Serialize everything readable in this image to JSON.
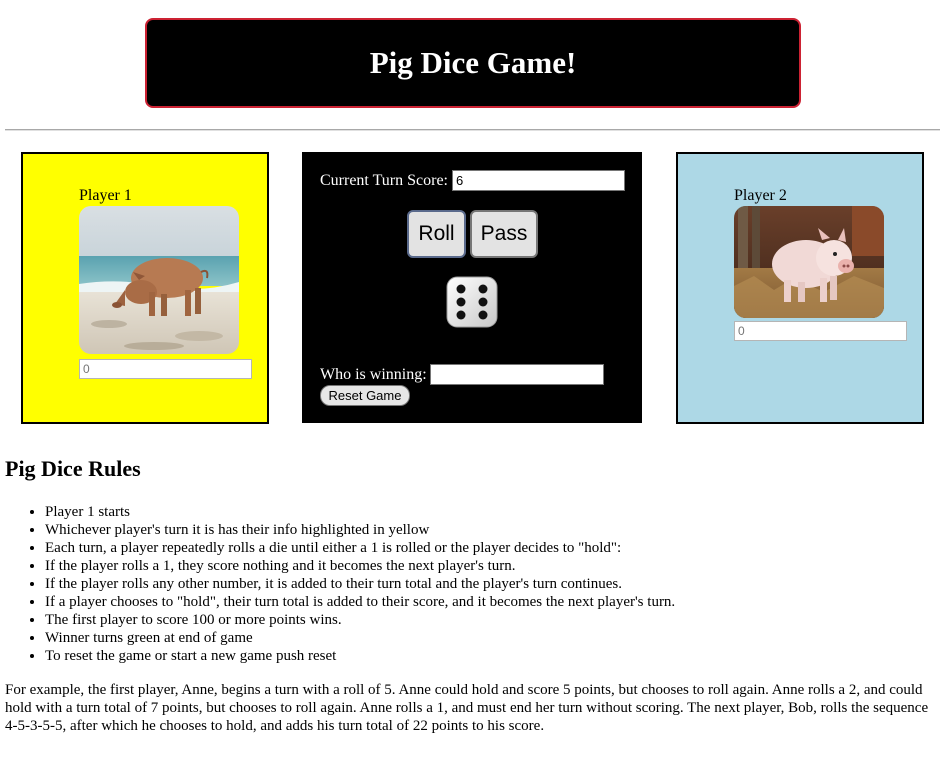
{
  "header": {
    "title": "Pig Dice Game!"
  },
  "player1": {
    "label": "Player 1",
    "score_placeholder": "0",
    "avatar_icon": "pig-on-beach-photo",
    "background_color": "#ffff00"
  },
  "player2": {
    "label": "Player 2",
    "score_placeholder": "0",
    "avatar_icon": "piglet-photo",
    "background_color": "#add8e6"
  },
  "controls": {
    "current_turn_label": "Current Turn Score:",
    "current_turn_value": "6",
    "roll_label": "Roll",
    "pass_label": "Pass",
    "die_face": 6,
    "die_icon": "dice-six-icon",
    "winning_label": "Who is winning:",
    "winning_value": "",
    "reset_label": "Reset Game"
  },
  "rules": {
    "heading": "Pig Dice Rules",
    "items": [
      "Player 1 starts",
      "Whichever player's turn it is has their info highlighted in yellow",
      "Each turn, a player repeatedly rolls a die until either a 1 is rolled or the player decides to \"hold\":",
      "If the player rolls a 1, they score nothing and it becomes the next player's turn.",
      "If the player rolls any other number, it is added to their turn total and the player's turn continues.",
      "If a player chooses to \"hold\", their turn total is added to their score, and it becomes the next player's turn.",
      "The first player to score 100 or more points wins.",
      "Winner turns green at end of game",
      "To reset the game or start a new game push reset"
    ],
    "example": "For example, the first player, Anne, begins a turn with a roll of 5. Anne could hold and score 5 points, but chooses to roll again. Anne rolls a 2, and could hold with a turn total of 7 points, but chooses to roll again. Anne rolls a 1, and must end her turn without scoring. The next player, Bob, rolls the sequence 4-5-3-5-5, after which he chooses to hold, and adds his turn total of 22 points to his score."
  }
}
